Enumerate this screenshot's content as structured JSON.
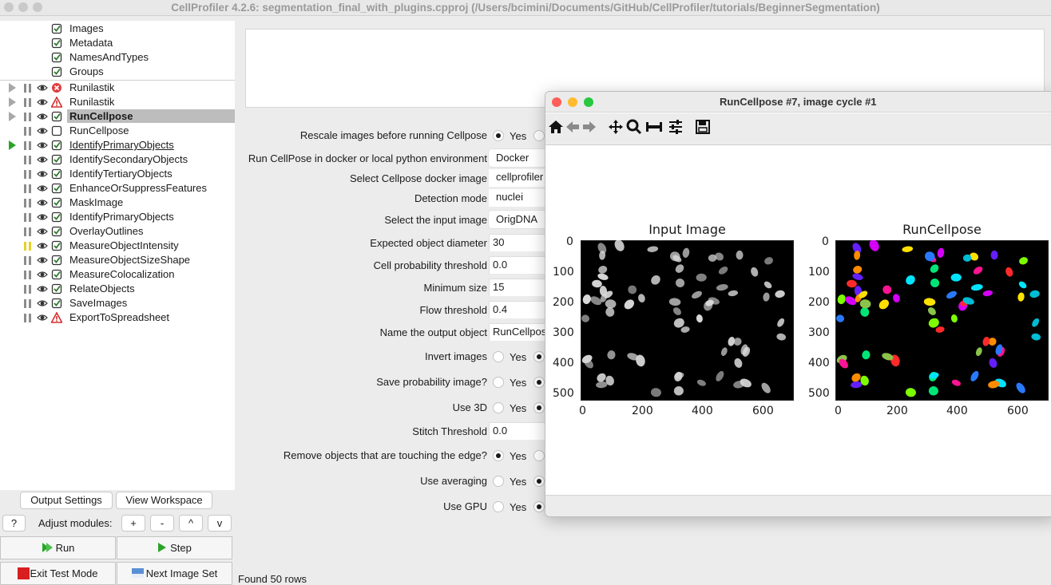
{
  "window": {
    "title": "CellProfiler 4.2.6: segmentation_final_with_plugins.cpproj (/Users/bcimini/Documents/GitHub/CellProfiler/tutorials/BeginnerSegmentation)"
  },
  "pipeline": {
    "input_modules": [
      {
        "name": "Images"
      },
      {
        "name": "Metadata"
      },
      {
        "name": "NamesAndTypes"
      },
      {
        "name": "Groups"
      }
    ],
    "modules": [
      {
        "name": "Runilastik",
        "status": "error",
        "expand": true,
        "pause_color": "gray",
        "selected": false,
        "underline": false
      },
      {
        "name": "Runilastik",
        "status": "warning",
        "expand": true,
        "pause_color": "gray",
        "selected": false,
        "underline": false
      },
      {
        "name": "RunCellpose",
        "status": "ok",
        "expand": true,
        "pause_color": "gray",
        "selected": true,
        "underline": false
      },
      {
        "name": "RunCellpose",
        "status": "unchecked",
        "expand": false,
        "pause_color": "gray",
        "selected": false,
        "underline": false
      },
      {
        "name": "IdentifyPrimaryObjects",
        "status": "ok",
        "expand": false,
        "play": true,
        "pause_color": "gray",
        "selected": false,
        "underline": true
      },
      {
        "name": "IdentifySecondaryObjects",
        "status": "ok",
        "expand": false,
        "pause_color": "gray",
        "selected": false,
        "underline": false
      },
      {
        "name": "IdentifyTertiaryObjects",
        "status": "ok",
        "expand": false,
        "pause_color": "gray",
        "selected": false,
        "underline": false
      },
      {
        "name": "EnhanceOrSuppressFeatures",
        "status": "ok",
        "expand": false,
        "pause_color": "gray",
        "selected": false,
        "underline": false
      },
      {
        "name": "MaskImage",
        "status": "ok",
        "expand": false,
        "pause_color": "gray",
        "selected": false,
        "underline": false
      },
      {
        "name": "IdentifyPrimaryObjects",
        "status": "ok",
        "expand": false,
        "pause_color": "gray",
        "selected": false,
        "underline": false
      },
      {
        "name": "OverlayOutlines",
        "status": "ok",
        "expand": false,
        "pause_color": "gray",
        "selected": false,
        "underline": false
      },
      {
        "name": "MeasureObjectIntensity",
        "status": "ok",
        "expand": false,
        "pause_color": "yellow",
        "selected": false,
        "underline": false
      },
      {
        "name": "MeasureObjectSizeShape",
        "status": "ok",
        "expand": false,
        "pause_color": "gray",
        "selected": false,
        "underline": false
      },
      {
        "name": "MeasureColocalization",
        "status": "ok",
        "expand": false,
        "pause_color": "gray",
        "selected": false,
        "underline": false
      },
      {
        "name": "RelateObjects",
        "status": "ok",
        "expand": false,
        "pause_color": "gray",
        "selected": false,
        "underline": false
      },
      {
        "name": "SaveImages",
        "status": "ok",
        "expand": false,
        "pause_color": "gray",
        "selected": false,
        "underline": false
      },
      {
        "name": "ExportToSpreadsheet",
        "status": "warning",
        "expand": false,
        "pause_color": "gray",
        "selected": false,
        "underline": false
      }
    ]
  },
  "controls": {
    "output_settings": "Output Settings",
    "view_workspace": "View Workspace",
    "help": "?",
    "adjust_label": "Adjust modules:",
    "add": "+",
    "remove": "-",
    "up": "^",
    "down": "v",
    "run": "Run",
    "step": "Step",
    "exit_test": "Exit Test Mode",
    "next_image_set": "Next Image Set"
  },
  "settings": {
    "rescale": {
      "label": "Rescale images before running Cellpose",
      "yes": "Yes",
      "selected": "Yes"
    },
    "env": {
      "label": "Run CellPose in docker or local python environment",
      "value": "Docker"
    },
    "docker_image": {
      "label": "Select Cellpose docker image",
      "value": "cellprofiler"
    },
    "detection_mode": {
      "label": "Detection mode",
      "value": "nuclei"
    },
    "input_image": {
      "label": "Select the input image",
      "value": "OrigDNA"
    },
    "diameter": {
      "label": "Expected object diameter",
      "value": "30"
    },
    "cell_prob": {
      "label": "Cell probability threshold",
      "value": "0.0"
    },
    "min_size": {
      "label": "Minimum size",
      "value": "15"
    },
    "flow": {
      "label": "Flow threshold",
      "value": "0.4"
    },
    "output_name": {
      "label": "Name the output object",
      "value": "RunCellpose"
    },
    "invert": {
      "label": "Invert images",
      "yes": "Yes",
      "selected": "No"
    },
    "save_prob": {
      "label": "Save probability image?",
      "yes": "Yes",
      "selected": "No"
    },
    "use3d": {
      "label": "Use 3D",
      "yes": "Yes",
      "selected": "No"
    },
    "stitch": {
      "label": "Stitch Threshold",
      "value": "0.0"
    },
    "remove_edge": {
      "label": "Remove objects that are touching the edge?",
      "yes": "Yes",
      "selected": "Yes"
    },
    "averaging": {
      "label": "Use averaging",
      "yes": "Yes",
      "selected": "No"
    },
    "gpu": {
      "label": "Use GPU",
      "yes": "Yes",
      "selected": "No"
    }
  },
  "status_bar": {
    "text": "Found 50 rows"
  },
  "figure_window": {
    "title": "RunCellpose #7, image cycle #1",
    "toolbar": [
      "home-icon",
      "back-icon",
      "forward-icon",
      "pan-icon",
      "zoom-icon",
      "subplots-icon",
      "configure-icon",
      "save-icon"
    ],
    "panels": [
      {
        "title": "Input Image",
        "x_ticks": [
          "0",
          "200",
          "400",
          "600"
        ],
        "y_ticks": [
          "0",
          "100",
          "200",
          "300",
          "400",
          "500"
        ]
      },
      {
        "title": "RunCellpose",
        "x_ticks": [
          "0",
          "200",
          "400",
          "600"
        ],
        "y_ticks": [
          "0",
          "100",
          "200",
          "300",
          "400",
          "500"
        ]
      }
    ],
    "colors": {
      "close": "#fe5f57",
      "minimize": "#febc2e",
      "maximize": "#28c840"
    }
  }
}
